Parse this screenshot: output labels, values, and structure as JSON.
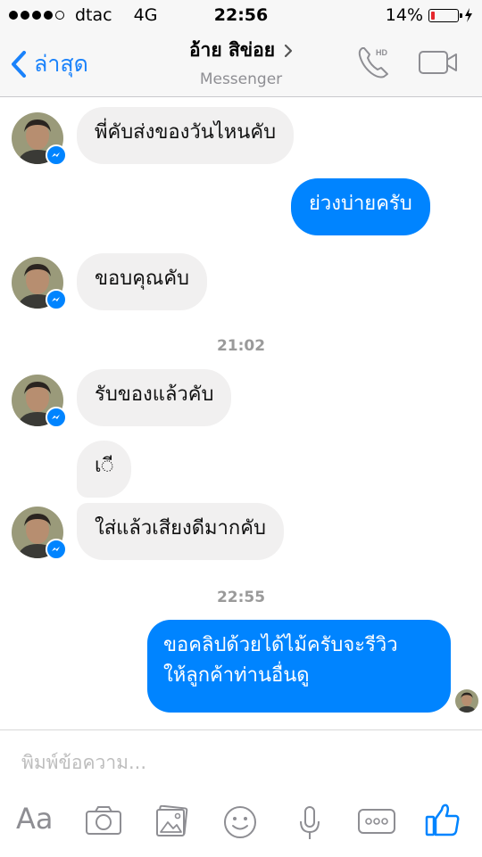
{
  "status": {
    "carrier": "dtac",
    "network": "4G",
    "time": "22:56",
    "battery": "14%",
    "battery_level": 0.14
  },
  "nav": {
    "back_label": "ล่าสุด",
    "title": "อ้าย สิข่อย",
    "subtitle": "Messenger",
    "call_hd": "HD"
  },
  "messages": [
    {
      "dir": "in",
      "text": "พี่คับส่งของวันไหนคับ"
    },
    {
      "dir": "out",
      "text": "ย่วงบ่ายครับ"
    },
    {
      "dir": "in",
      "text": "ขอบคุณคับ"
    },
    {
      "timestamp": "21:02"
    },
    {
      "dir": "in",
      "text": "รับของแล้วคับ"
    },
    {
      "dir": "in",
      "text": "เ◌ี"
    },
    {
      "dir": "in",
      "text": "ใส่แล้วเสียงดีมากคับ"
    },
    {
      "timestamp": "22:55"
    },
    {
      "dir": "out",
      "text": "ขอคลิปด้วยได้ไม้ครับจะรีวิว\nให้ลูกค้าท่านอื่นดู"
    }
  ],
  "composer": {
    "placeholder": "พิมพ์ข้อความ...",
    "aa_label": "Aa",
    "more_label": "ooo"
  },
  "colors": {
    "accent": "#1a82fb",
    "outgoing_bubble": "#0084ff",
    "incoming_bubble": "#f1f0f0",
    "battery_low": "#e5262c"
  }
}
